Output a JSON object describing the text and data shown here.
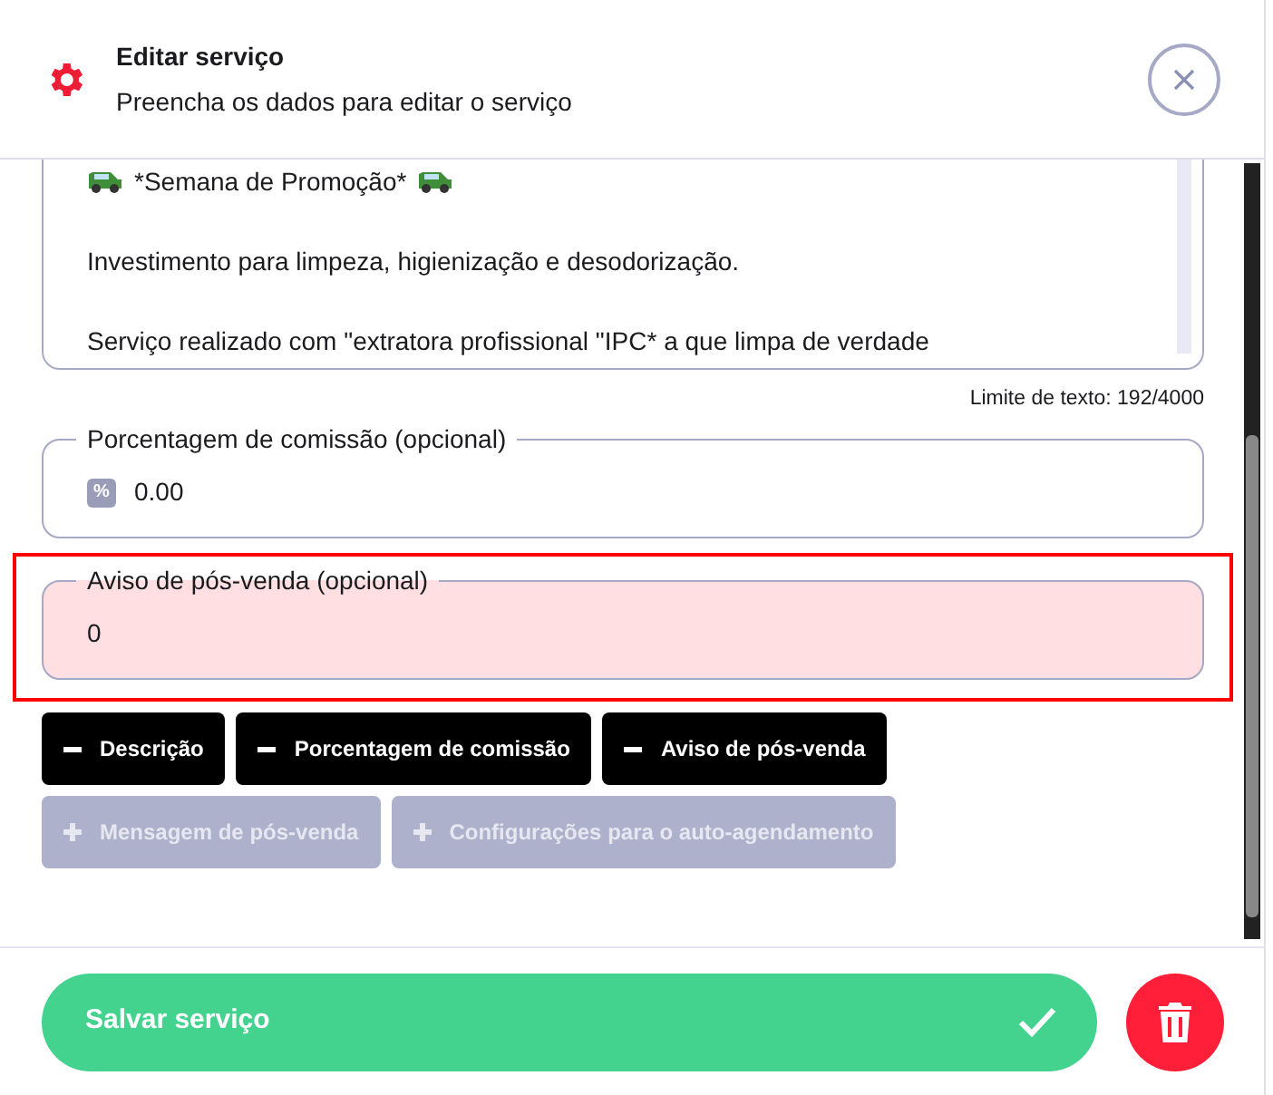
{
  "header": {
    "title": "Editar serviço",
    "subtitle": "Preencha os dados para editar o serviço"
  },
  "description": {
    "lines": [
      {
        "text": "*Semana de Promoção*",
        "car_icons": true
      },
      {
        "text": "Investimento para limpeza, higienização e desodorização.",
        "car_icons": false
      },
      {
        "text": "Serviço realizado com \"extratora profissional \"IPC* a que limpa de verdade",
        "car_icons": false
      }
    ],
    "counter": "Limite de texto: 192/4000"
  },
  "fields": [
    {
      "label": "Porcentagem de comissão (opcional)",
      "value": "0.00",
      "prefix": "%",
      "highlighted": false
    },
    {
      "label": "Aviso de pós-venda (opcional)",
      "value": "0",
      "highlighted": true
    }
  ],
  "toggles": [
    {
      "label": "Descrição",
      "active": true
    },
    {
      "label": "Porcentagem de comissão",
      "active": true
    },
    {
      "label": "Aviso de pós-venda",
      "active": true
    },
    {
      "label": "Mensagem de pós-venda",
      "active": false
    },
    {
      "label": "Configurações para o auto-agendamento",
      "active": false
    }
  ],
  "footer": {
    "save_label": "Salvar serviço"
  }
}
